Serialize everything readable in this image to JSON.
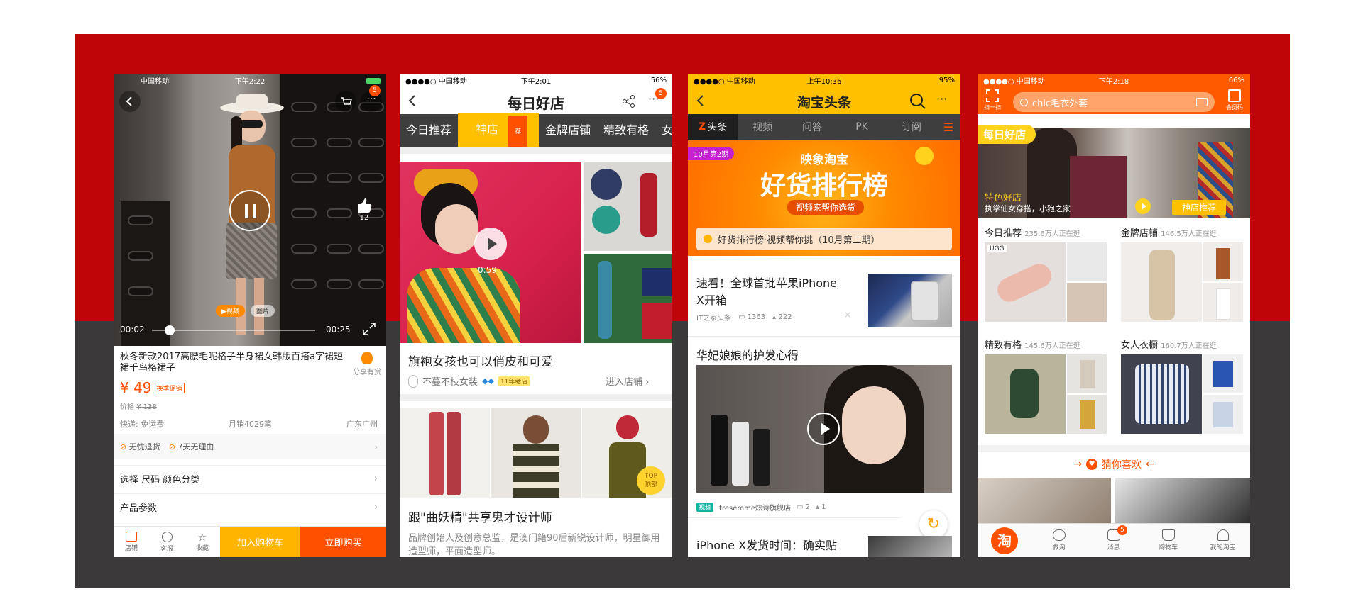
{
  "phone1": {
    "status": {
      "carrier": "中国移动",
      "time": "下午2:22"
    },
    "cart_count": "5",
    "like_count": "12",
    "media_tabs": [
      "视频",
      "图片"
    ],
    "video_current": "00:02",
    "video_total": "00:25",
    "product_title": "秋冬新款2017高腰毛呢格子半身裙女韩版百搭a字裙短裙千鸟格裙子",
    "share_label": "分享有赏",
    "price": "¥ 49",
    "promo_tag": "换季促销",
    "original_price_label": "价格",
    "original_price": "¥ 138",
    "shipping": "快递: 免运费",
    "monthly_sales": "月销4029笔",
    "location": "广东广州",
    "services": [
      "无忧退货",
      "7天无理由"
    ],
    "option_select": "选择  尺码 颜色分类",
    "option_params": "产品参数",
    "bottom": {
      "shop": "店铺",
      "service": "客服",
      "favorite": "收藏",
      "add_cart": "加入购物车",
      "buy_now": "立即购买"
    }
  },
  "phone2": {
    "status": {
      "carrier": "●●●●○ 中国移动",
      "time": "下午2:01",
      "battery": "56%"
    },
    "title": "每日好店",
    "more_count": "5",
    "tabs": [
      "今日推荐",
      "神店",
      "金牌店铺",
      "精致有格",
      "女人"
    ],
    "tab_badge": "荐",
    "video_duration": "0:59",
    "post1_title": "旗袍女孩也可以俏皮和可爱",
    "post1_shop": "不蔓不枝女装",
    "post1_age_tag": "11年老店",
    "post1_enter": "进入店铺",
    "top_button": [
      "TOP",
      "顶部"
    ],
    "post2_title": "跟\"曲妖精\"共享鬼才设计师",
    "post2_desc": "品牌创始人及创意总监，是澳门籍90后新锐设计师，明星御用造型师，平面造型师。"
  },
  "phone3": {
    "status": {
      "carrier": "●●●●○ 中国移动",
      "time": "上午10:36",
      "battery": "95%"
    },
    "title": "淘宝头条",
    "tabs": [
      "头条",
      "视频",
      "问答",
      "PK",
      "订阅"
    ],
    "banner_period": "10月第2期",
    "banner_brand": "映象淘宝",
    "banner_title": "好货排行榜",
    "banner_sub": "视频来帮你选货",
    "banner_caption": "好货排行榜·视频帮你挑（10月第二期）",
    "article1_title": "速看！全球首批苹果iPhone X开箱",
    "article1_source": "IT之家头条",
    "article1_comments": "1363",
    "article1_likes": "222",
    "article2_title": "华妃娘娘的护发心得",
    "article2_tag": "视频",
    "article2_source": "tresemme炫诗旗舰店",
    "article2_comments": "2",
    "article2_likes": "1",
    "article3_title": "iPhone X发货时间：确实贴"
  },
  "phone4": {
    "status": {
      "carrier": "●●●●○ 中国移动",
      "time": "下午2:18",
      "battery": "66%"
    },
    "scan_label": "扫一扫",
    "search_placeholder": "chic毛衣外套",
    "member_label": "会员码",
    "banner_tag": "每日好店",
    "banner_shop": "特色好店",
    "banner_desc": "执掌仙女穿搭，小狍之家",
    "banner_button": "神店推荐",
    "cats": [
      {
        "name": "今日推荐",
        "count": "235.6万人正在逛"
      },
      {
        "name": "金牌店铺",
        "count": "146.5万人正在逛"
      },
      {
        "name": "精致有格",
        "count": "145.6万人正在逛"
      },
      {
        "name": "女人衣橱",
        "count": "160.7万人正在逛"
      }
    ],
    "brand_badge": "UGG",
    "guess_title": "猜你喜欢",
    "message_count": "5",
    "tabbar": [
      "淘",
      "微淘",
      "消息",
      "购物车",
      "我的淘宝"
    ]
  }
}
